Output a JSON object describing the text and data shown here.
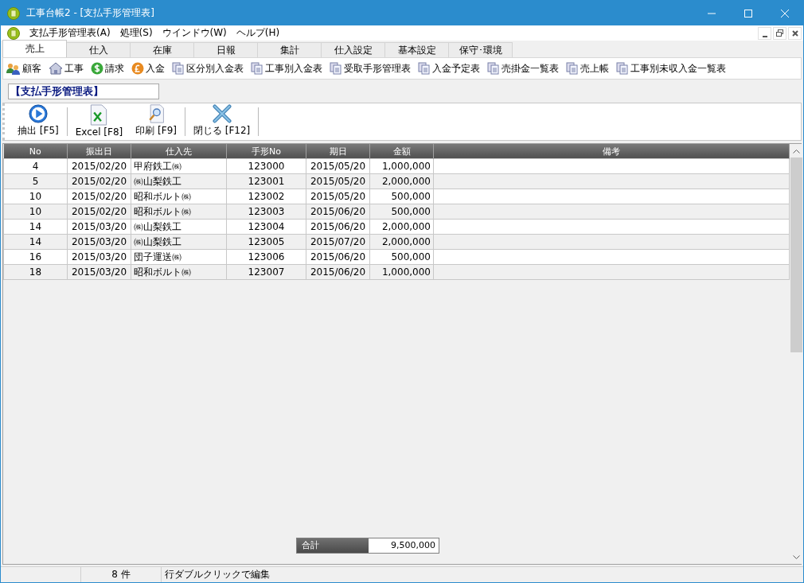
{
  "window": {
    "title": "工事台帳2 - [支払手形管理表]"
  },
  "menu": [
    "支払手形管理表(A)",
    "処理(S)",
    "ウインドウ(W)",
    "ヘルプ(H)"
  ],
  "tabs": [
    {
      "label": "売上",
      "selected": true
    },
    {
      "label": "仕入",
      "selected": false
    },
    {
      "label": "在庫",
      "selected": false
    },
    {
      "label": "日報",
      "selected": false
    },
    {
      "label": "集計",
      "selected": false
    },
    {
      "label": "仕入設定",
      "selected": false
    },
    {
      "label": "基本設定",
      "selected": false
    },
    {
      "label": "保守･環境",
      "selected": false
    }
  ],
  "nav": [
    {
      "label": "顧客",
      "kind": "people"
    },
    {
      "label": "工事",
      "kind": "house"
    },
    {
      "label": "請求",
      "kind": "dollar"
    },
    {
      "label": "入金",
      "kind": "pound"
    },
    {
      "label": "区分別入金表",
      "kind": "report"
    },
    {
      "label": "工事別入金表",
      "kind": "report"
    },
    {
      "label": "受取手形管理表",
      "kind": "report"
    },
    {
      "label": "入金予定表",
      "kind": "report"
    },
    {
      "label": "売掛金一覧表",
      "kind": "report"
    },
    {
      "label": "売上帳",
      "kind": "report"
    },
    {
      "label": "工事別未収入金一覧表",
      "kind": "report"
    }
  ],
  "page_title": "【支払手形管理表】",
  "actions": [
    {
      "label": "抽出 [F5]",
      "kind": "run"
    },
    {
      "label": "Excel [F8]",
      "kind": "excel"
    },
    {
      "label": "印刷 [F9]",
      "kind": "print"
    },
    {
      "label": "閉じる [F12]",
      "kind": "close"
    }
  ],
  "table": {
    "columns": [
      "No",
      "振出日",
      "仕入先",
      "手形No",
      "期日",
      "金額",
      "備考"
    ],
    "rows": [
      [
        "4",
        "2015/02/20",
        "甲府鉄工㈱",
        "123000",
        "2015/05/20",
        "1,000,000",
        ""
      ],
      [
        "5",
        "2015/02/20",
        "㈱山梨鉄工",
        "123001",
        "2015/05/20",
        "2,000,000",
        ""
      ],
      [
        "10",
        "2015/02/20",
        "昭和ボルト㈱",
        "123002",
        "2015/05/20",
        "500,000",
        ""
      ],
      [
        "10",
        "2015/02/20",
        "昭和ボルト㈱",
        "123003",
        "2015/06/20",
        "500,000",
        ""
      ],
      [
        "14",
        "2015/03/20",
        "㈱山梨鉄工",
        "123004",
        "2015/06/20",
        "2,000,000",
        ""
      ],
      [
        "14",
        "2015/03/20",
        "㈱山梨鉄工",
        "123005",
        "2015/07/20",
        "2,000,000",
        ""
      ],
      [
        "16",
        "2015/03/20",
        "団子運送㈱",
        "123006",
        "2015/06/20",
        "500,000",
        ""
      ],
      [
        "18",
        "2015/03/20",
        "昭和ボルト㈱",
        "123007",
        "2015/06/20",
        "1,000,000",
        ""
      ]
    ]
  },
  "total": {
    "label": "合計",
    "value": "9,500,000"
  },
  "status_bar": {
    "count": "8 件",
    "hint": "行ダブルクリックで編集"
  }
}
